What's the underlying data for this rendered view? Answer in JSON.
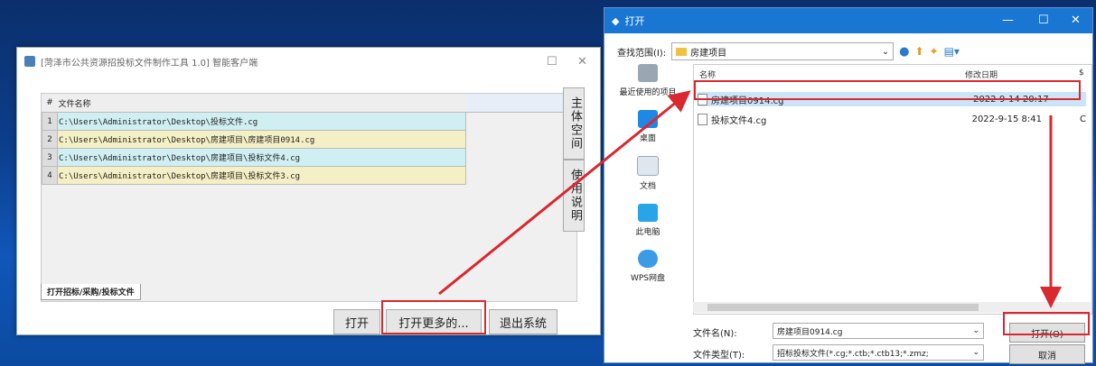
{
  "left_window": {
    "title": "[菏泽市公共资源招投标文件制作工具 1.0] 智能客户端",
    "grid_header": {
      "col_marker": "#",
      "col_name": "文件名称"
    },
    "rows": [
      {
        "num": "1",
        "path": "C:\\Users\\Administrator\\Desktop\\投标文件.cg"
      },
      {
        "num": "2",
        "path": "C:\\Users\\Administrator\\Desktop\\房建项目\\房建项目0914.cg"
      },
      {
        "num": "3",
        "path": "C:\\Users\\Administrator\\Desktop\\房建项目\\投标文件4.cg"
      },
      {
        "num": "4",
        "path": "C:\\Users\\Administrator\\Desktop\\房建项目\\投标文件3.cg"
      }
    ],
    "side_buttons": {
      "main_site": "主体空间",
      "instructions": "使用说明"
    },
    "tab_label": "打开招标/采购/投标文件",
    "buttons": {
      "open": "打开",
      "open_more": "打开更多的...",
      "exit": "退出系统"
    }
  },
  "right_window": {
    "title": "打开",
    "look_in_label": "查找范围(I):",
    "look_in_value": "房建项目",
    "places": [
      {
        "label": "最近使用的项目",
        "icon": "recent-icon"
      },
      {
        "label": "桌面",
        "icon": "desktop-icon"
      },
      {
        "label": "文档",
        "icon": "documents-icon"
      },
      {
        "label": "此电脑",
        "icon": "computer-icon"
      },
      {
        "label": "WPS网盘",
        "icon": "cloud-icon"
      }
    ],
    "columns": {
      "name": "名称",
      "date": "修改日期",
      "extra": "$"
    },
    "files": [
      {
        "name": "房建项目0914.cg",
        "date": "2022-9-14 20:17",
        "extra": ""
      },
      {
        "name": "投标文件4.cg",
        "date": "2022-9-15 8:41",
        "extra": "C"
      }
    ],
    "filename_label": "文件名(N):",
    "filename_value": "房建项目0914.cg",
    "filetype_label": "文件类型(T):",
    "filetype_value": "招标投标文件(*.cg;*.ctb;*.ctb13;*.zmz;",
    "open_button": "打开(O)",
    "cancel_button": "取消"
  },
  "colors": {
    "highlight": "#d9282f",
    "title_blue": "#1976d2"
  }
}
